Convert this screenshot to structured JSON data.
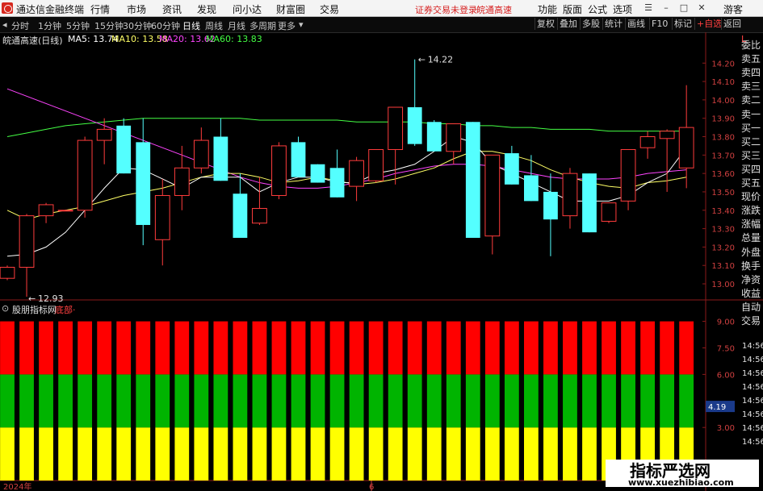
{
  "app": {
    "title": "通达信金融终端"
  },
  "menu": {
    "items": [
      "行情",
      "市场",
      "资讯",
      "发现",
      "问小达",
      "财富圈",
      "交易"
    ],
    "alert": "证券交易未登录",
    "stock_name": "皖通高速",
    "right_items": [
      "功能",
      "版面",
      "公式",
      "选项"
    ],
    "guest": "游客"
  },
  "toolbar": {
    "periods": [
      "分时",
      "1分钟",
      "5分钟",
      "15分钟",
      "30分钟",
      "60分钟",
      "日线",
      "周线",
      "月线",
      "多周期",
      "更多"
    ],
    "active_period": "日线",
    "right_buttons": [
      "复权",
      "叠加",
      "多股",
      "统计",
      "画线",
      "F10",
      "标记",
      "+自选",
      "返回"
    ]
  },
  "chart": {
    "stock_label": "皖通高速(日线)",
    "ma": [
      {
        "label": "MA5: 13.74",
        "color": "#ffffff"
      },
      {
        "label": "MA10: 13.58",
        "color": "#ffff66"
      },
      {
        "label": "MA20: 13.62",
        "color": "#ff44ff"
      },
      {
        "label": "MA60: 13.83",
        "color": "#44ff44"
      }
    ],
    "high_label": "14.22",
    "low_label": "12.93",
    "y_ticks": [
      "14.20",
      "14.10",
      "14.00",
      "13.90",
      "13.80",
      "13.70",
      "13.60",
      "13.50",
      "13.40",
      "13.30",
      "13.20",
      "13.10",
      "13.00"
    ],
    "indicator_name": "股朋指标网",
    "indicator_tag": "底部·",
    "ind_ticks": [
      "9.00",
      "7.50",
      "6.00",
      "4.19",
      "3.00"
    ],
    "x_labels": [
      "2024年",
      "6"
    ]
  },
  "side_panel": {
    "top_mark": "L",
    "labels": [
      "委比",
      "卖五",
      "卖四",
      "卖三",
      "卖二",
      "卖一",
      "买一",
      "买二",
      "买三",
      "买四",
      "买五",
      "现价",
      "涨跌",
      "涨幅",
      "总量",
      "外盘",
      "换手",
      "净资",
      "收益",
      "自动",
      "交易"
    ],
    "times": [
      "14:56",
      "14:56",
      "14:56",
      "14:56",
      "14:56",
      "14:56",
      "14:56",
      "14:56"
    ]
  },
  "watermark": {
    "cn": "指标严选网",
    "url": "www.xuezhibiao.com"
  },
  "colors": {
    "up": "#ff3c3c",
    "down": "#54ffff",
    "ma60": "#44ff44",
    "ma20": "#ff44ff",
    "ma10": "#ffff66",
    "ma5": "#ffffff",
    "band_red": "#ff0000",
    "band_green": "#00b400",
    "band_yellow": "#ffff00"
  },
  "chart_data": {
    "type": "candlestick",
    "candles": [
      [
        13.03,
        13.1,
        13.02,
        13.09
      ],
      [
        13.09,
        13.38,
        12.93,
        13.37
      ],
      [
        13.37,
        13.44,
        13.33,
        13.43
      ],
      [
        13.4,
        13.4,
        13.4,
        13.4
      ],
      [
        13.4,
        13.8,
        13.36,
        13.78
      ],
      [
        13.78,
        13.9,
        13.65,
        13.84
      ],
      [
        13.86,
        13.9,
        13.6,
        13.6
      ],
      [
        13.77,
        13.9,
        13.21,
        13.32
      ],
      [
        13.24,
        13.57,
        13.1,
        13.48
      ],
      [
        13.48,
        13.75,
        13.4,
        13.63
      ],
      [
        13.63,
        13.85,
        13.6,
        13.78
      ],
      [
        13.8,
        13.9,
        13.56,
        13.56
      ],
      [
        13.49,
        13.6,
        13.25,
        13.25
      ],
      [
        13.33,
        13.58,
        13.32,
        13.41
      ],
      [
        13.48,
        13.77,
        13.46,
        13.75
      ],
      [
        13.77,
        13.8,
        13.58,
        13.58
      ],
      [
        13.65,
        13.65,
        13.55,
        13.55
      ],
      [
        13.63,
        13.73,
        13.47,
        13.47
      ],
      [
        13.53,
        13.69,
        13.45,
        13.67
      ],
      [
        13.56,
        13.73,
        13.55,
        13.73
      ],
      [
        13.73,
        13.96,
        13.54,
        13.96
      ],
      [
        13.96,
        14.22,
        13.75,
        13.76
      ],
      [
        13.88,
        13.89,
        13.72,
        13.72
      ],
      [
        13.72,
        13.87,
        13.65,
        13.87
      ],
      [
        13.88,
        13.88,
        13.25,
        13.25
      ],
      [
        13.26,
        13.7,
        13.16,
        13.7
      ],
      [
        13.71,
        13.75,
        13.54,
        13.54
      ],
      [
        13.59,
        13.7,
        13.45,
        13.45
      ],
      [
        13.5,
        13.6,
        13.15,
        13.35
      ],
      [
        13.37,
        13.63,
        13.3,
        13.6
      ],
      [
        13.6,
        13.6,
        13.28,
        13.28
      ],
      [
        13.34,
        13.44,
        13.33,
        13.44
      ],
      [
        13.45,
        13.7,
        13.4,
        13.73
      ],
      [
        13.74,
        13.83,
        13.68,
        13.8
      ],
      [
        13.79,
        13.84,
        13.5,
        13.83
      ],
      [
        13.63,
        14.08,
        13.52,
        13.85
      ]
    ],
    "ma5": [
      13.15,
      13.16,
      13.2,
      13.28,
      13.4,
      13.52,
      13.63,
      13.62,
      13.57,
      13.52,
      13.58,
      13.58,
      13.58,
      13.5,
      13.55,
      13.58,
      13.58,
      13.55,
      13.55,
      13.6,
      13.62,
      13.65,
      13.72,
      13.8,
      13.77,
      13.65,
      13.6,
      13.55,
      13.5,
      13.45,
      13.45,
      13.45,
      13.48,
      13.55,
      13.6,
      13.74
    ],
    "ma10": [
      13.4,
      13.35,
      13.38,
      13.4,
      13.42,
      13.45,
      13.48,
      13.5,
      13.52,
      13.55,
      13.58,
      13.6,
      13.6,
      13.58,
      13.55,
      13.56,
      13.58,
      13.56,
      13.54,
      13.55,
      13.57,
      13.6,
      13.63,
      13.68,
      13.72,
      13.72,
      13.7,
      13.67,
      13.62,
      13.58,
      13.55,
      13.53,
      13.52,
      13.55,
      13.56,
      13.58
    ],
    "ma20": [
      14.06,
      14.02,
      13.98,
      13.94,
      13.9,
      13.86,
      13.82,
      13.78,
      13.74,
      13.7,
      13.66,
      13.62,
      13.58,
      13.55,
      13.53,
      13.52,
      13.52,
      13.53,
      13.55,
      13.57,
      13.6,
      13.62,
      13.64,
      13.65,
      13.65,
      13.64,
      13.62,
      13.6,
      13.58,
      13.57,
      13.57,
      13.57,
      13.58,
      13.6,
      13.61,
      13.62
    ],
    "ma60": [
      13.8,
      13.82,
      13.84,
      13.86,
      13.87,
      13.88,
      13.89,
      13.9,
      13.9,
      13.9,
      13.9,
      13.9,
      13.9,
      13.89,
      13.89,
      13.89,
      13.89,
      13.89,
      13.88,
      13.88,
      13.88,
      13.88,
      13.87,
      13.87,
      13.86,
      13.86,
      13.85,
      13.85,
      13.84,
      13.84,
      13.84,
      13.83,
      13.83,
      13.83,
      13.83,
      13.83
    ],
    "ylim": [
      12.93,
      14.28
    ],
    "indicator": {
      "bars": 36,
      "bands": [
        {
          "color": "band_yellow",
          "from": 0,
          "to": 3
        },
        {
          "color": "band_green",
          "from": 3,
          "to": 6
        },
        {
          "color": "band_red",
          "from": 6,
          "to": 9
        }
      ],
      "ylim": [
        0,
        9.3
      ]
    }
  }
}
